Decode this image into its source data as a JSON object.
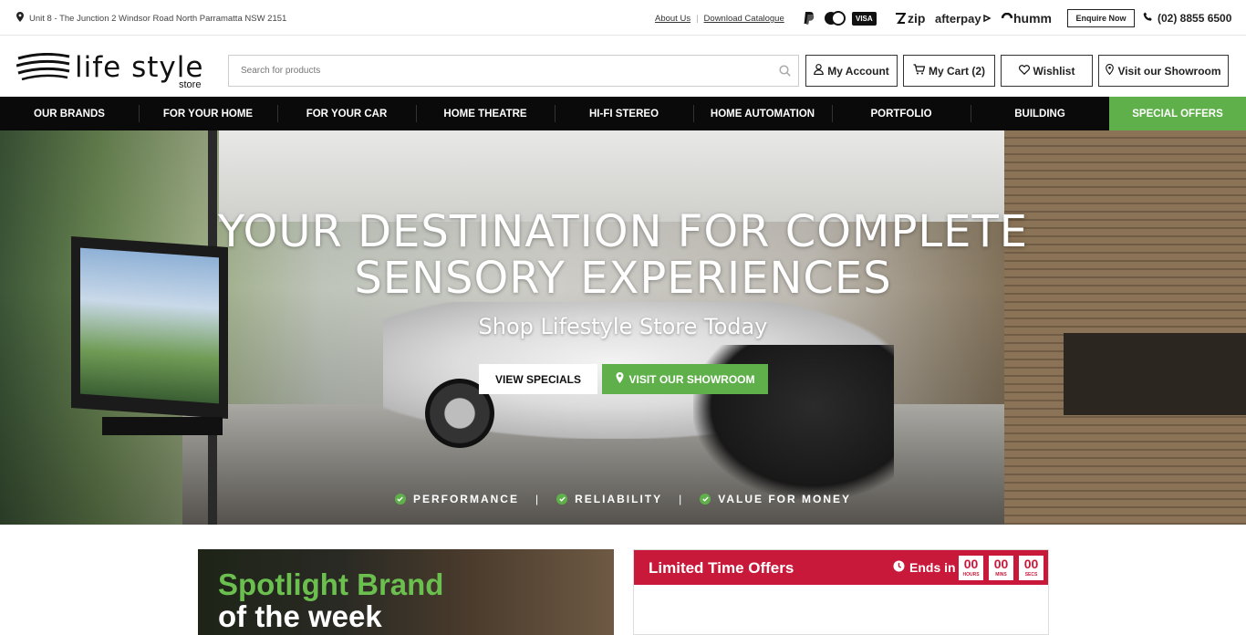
{
  "topbar": {
    "address": "Unit 8 - The Junction 2 Windsor Road North Parramatta NSW 2151",
    "about": "About Us",
    "catalogue": "Download Catalogue",
    "payments": {
      "zip": "zip",
      "afterpay": "afterpay",
      "humm": "humm",
      "visa": "VISA"
    },
    "enquire": "Enquire Now",
    "phone": "(02) 8855 6500"
  },
  "header": {
    "logo_word": "life style",
    "logo_sub": "store",
    "search_placeholder": "Search for products",
    "account": "My Account",
    "cart": "My Cart (2)",
    "wishlist": "Wishlist",
    "showroom": "Visit our Showroom"
  },
  "nav": {
    "items": [
      "OUR BRANDS",
      "FOR YOUR HOME",
      "FOR YOUR CAR",
      "HOME THEATRE",
      "HI-FI STEREO",
      "HOME AUTOMATION",
      "PORTFOLIO",
      "BUILDING"
    ],
    "special": "SPECIAL OFFERS"
  },
  "hero": {
    "headline_line1": "YOUR DESTINATION FOR COMPLETE",
    "headline_line2": "SENSORY EXPERIENCES",
    "subtitle": "Shop Lifestyle Store Today",
    "cta_specials": "VIEW SPECIALS",
    "cta_showroom": "VISIT OUR SHOWROOM",
    "features": [
      "PERFORMANCE",
      "RELIABILITY",
      "VALUE FOR MONEY"
    ]
  },
  "spotlight": {
    "line1": "Spotlight Brand",
    "line2": "of the week"
  },
  "offers": {
    "title": "Limited Time Offers",
    "ends_in": "Ends in",
    "timer": [
      {
        "value": "00",
        "unit": "HOURS"
      },
      {
        "value": "00",
        "unit": "MINS"
      },
      {
        "value": "00",
        "unit": "SECS"
      }
    ]
  },
  "colors": {
    "accent_green": "#5fb04a",
    "offer_red": "#c8193b",
    "nav_black": "#0a0a0a"
  }
}
